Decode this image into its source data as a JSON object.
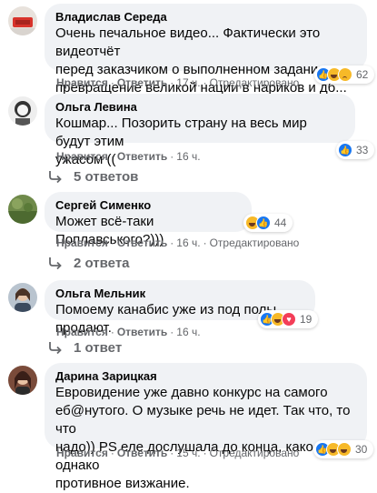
{
  "actions": {
    "like": "Нравится",
    "reply": "Ответить",
    "edited": "Отредактировано",
    "separator": "·"
  },
  "comments": [
    {
      "author": "Владислав Середа",
      "lines": [
        "Очень печальное видео... Фактически это видеотчёт",
        "перед заказчиком о выполненном задании-",
        "превращение великой нации в нариков и дб..."
      ],
      "time": "17 ч.",
      "edited": true,
      "reactions": [
        "like",
        "haha",
        "sad"
      ],
      "reaction_count": "62"
    },
    {
      "author": "Ольга Левина",
      "lines": [
        "Кошмар... Позорить страну на весь мир будут этим",
        "ужасом (("
      ],
      "time": "16 ч.",
      "edited": false,
      "reactions": [
        "like"
      ],
      "reaction_count": "33",
      "replies": "5 ответов"
    },
    {
      "author": "Сергей Сименко",
      "lines": [
        "Может всё-таки Поплавського?)))"
      ],
      "time": "16 ч.",
      "edited": true,
      "reactions": [
        "haha",
        "like"
      ],
      "reaction_count": "44",
      "replies": "2 ответа"
    },
    {
      "author": "Ольга Мельник",
      "lines": [
        "Помоему канабис уже из под полы продают."
      ],
      "time": "16 ч.",
      "edited": false,
      "reactions": [
        "like",
        "haha",
        "love"
      ],
      "reaction_count": "19",
      "replies": "1 ответ"
    },
    {
      "author": "Дарина Зарицкая",
      "lines": [
        "Евровидение уже давно конкурс на самого",
        "еб@нутого. О музыке речь не идет. Так что, то что",
        "надо)) PS еле дослушала до конца, какое однако",
        "противное визжание."
      ],
      "time": "15 ч.",
      "edited": true,
      "reactions": [
        "like",
        "haha",
        "haha"
      ],
      "reaction_count": "30"
    }
  ]
}
